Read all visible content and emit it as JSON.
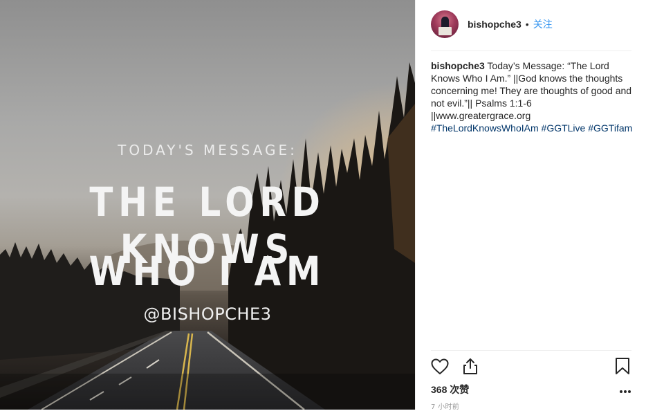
{
  "post": {
    "image": {
      "kicker": "TODAY'S MESSAGE:",
      "line1": "THE LORD KNOWS",
      "line2": "WHO I AM",
      "handle": "@BISHOPCHE3"
    },
    "author": {
      "username": "bishopche3",
      "separator": "•",
      "follow_label": "关注"
    },
    "caption": {
      "username": "bishopche3",
      "text": " Today’s Message: “The Lord Knows Who I Am.” ||God knows the thoughts concerning me! They are thoughts of good and not evil.”|| Psalms 1:1-6 ||www.greatergrace.org ",
      "hashtags": [
        "#TheLordKnowsWhoIAm",
        "#GGTLive",
        "#GGTifam"
      ]
    },
    "actions": {
      "icons": [
        "heart-icon",
        "share-icon",
        "bookmark-icon",
        "more-icon"
      ]
    },
    "likes": {
      "count": "368",
      "label": "次赞"
    },
    "timestamp": "7 小时前"
  },
  "colors": {
    "link": "#3897f0",
    "hashtag": "#003569",
    "text": "#262626",
    "muted": "#999999"
  }
}
